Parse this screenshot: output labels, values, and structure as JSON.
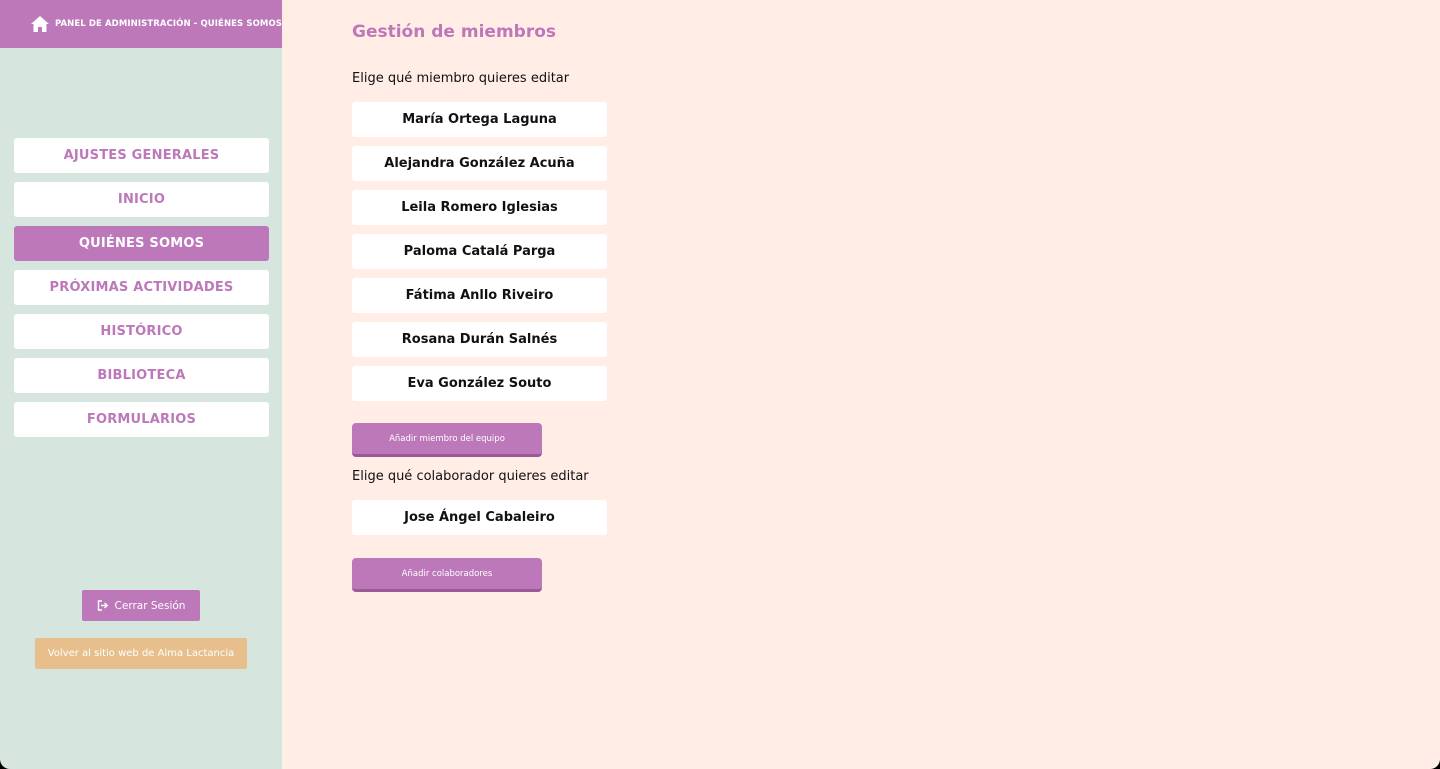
{
  "header": {
    "title": "PANEL DE ADMINISTRACIÓN - QUIÉNES SOMOS",
    "icon": "home-icon"
  },
  "sidebar": {
    "items": [
      {
        "label": "AJUSTES GENERALES",
        "active": false
      },
      {
        "label": "INICIO",
        "active": false
      },
      {
        "label": "QUIÉNES SOMOS",
        "active": true
      },
      {
        "label": "PRÓXIMAS ACTIVIDADES",
        "active": false
      },
      {
        "label": "HISTÓRICO",
        "active": false
      },
      {
        "label": "BIBLIOTECA",
        "active": false
      },
      {
        "label": "FORMULARIOS",
        "active": false
      }
    ],
    "logout_label": "Cerrar Sesión",
    "back_label": "Volver al sitio web de Alma Lactancia"
  },
  "main": {
    "title": "Gestión de miembros",
    "members_prompt": "Elige qué miembro quieres editar",
    "members": [
      "María Ortega Laguna",
      "Alejandra González Acuña",
      "Leila Romero Iglesias",
      "Paloma Catalá Parga",
      "Fátima Anllo Riveiro",
      "Rosana Durán Salnés",
      "Eva González Souto"
    ],
    "add_member_label": "Añadir miembro del equipo",
    "collaborators_prompt": "Elige qué colaborador quieres editar",
    "collaborators": [
      "Jose Ángel Cabaleiro"
    ],
    "add_collaborator_label": "Añadir colaboradores"
  },
  "colors": {
    "accent": "#bc78b9",
    "sidebar_bg": "#d7e5df",
    "main_bg": "#ffede6",
    "back_button": "#e6bf8c"
  }
}
